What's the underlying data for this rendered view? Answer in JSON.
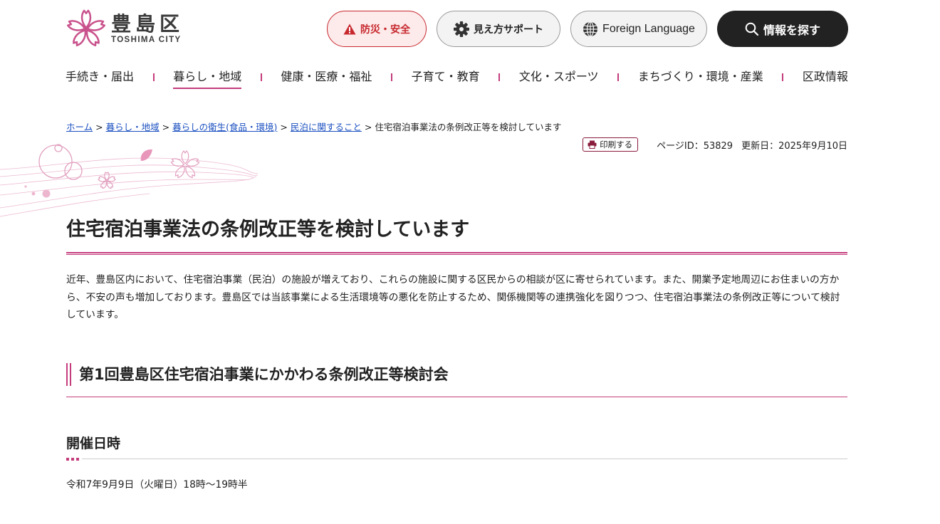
{
  "header": {
    "logo_jp": "豊島区",
    "logo_en": "TOSHIMA CITY",
    "disaster_label": "防災・安全",
    "view_support_label": "見え方サポート",
    "language_label": "Foreign Language",
    "search_label": "情報を探す"
  },
  "nav": {
    "items": [
      {
        "label": "手続き・届出"
      },
      {
        "label": "暮らし・地域",
        "active": true
      },
      {
        "label": "健康・医療・福祉"
      },
      {
        "label": "子育て・教育"
      },
      {
        "label": "文化・スポーツ"
      },
      {
        "label": "まちづくり・環境・産業"
      },
      {
        "label": "区政情報"
      }
    ]
  },
  "breadcrumb": {
    "items": [
      "ホーム",
      "暮らし・地域",
      "暮らしの衛生(食品・環境)",
      "民泊に関すること"
    ],
    "current": "住宅宿泊事業法の条例改正等を検討しています",
    "separator": ">"
  },
  "meta": {
    "print_label": "印刷する",
    "page_id": "ページID：53829",
    "updated": "更新日：2025年9月10日"
  },
  "page_title": "住宅宿泊事業法の条例改正等を検討しています",
  "intro": "近年、豊島区内において、住宅宿泊事業（民泊）の施設が増えており、これらの施設に関する区民からの相談が区に寄せられています。また、開業予定地周辺にお住まいの方から、不安の声も増加しております。豊島区では当該事業による生活環境等の悪化を防止するため、関係機関等の連携強化を図りつつ、住宅宿泊事業法の条例改正等について検討しています。",
  "section": {
    "heading": "第1回豊島区住宅宿泊事業にかかわる条例改正等検討会",
    "subheading": "開催日時",
    "date_text": "令和7年9月9日（火曜日）18時～19時半"
  },
  "colors": {
    "accent": "#c43c7c",
    "disaster": "#c7292f",
    "link": "#1a4fc0",
    "search_bg": "#222222"
  }
}
